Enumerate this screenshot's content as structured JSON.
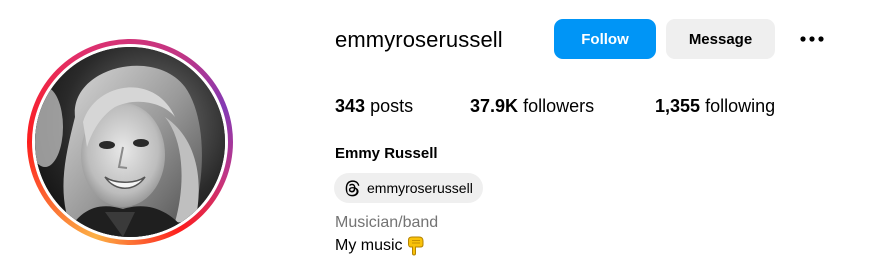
{
  "profile": {
    "username": "emmyroserussell",
    "full_name": "Emmy Russell",
    "threads_handle": "emmyroserussell",
    "category": "Musician/band",
    "bio_line": "My music",
    "bio_emoji_icon": "hand-pointing-down-icon"
  },
  "actions": {
    "follow_label": "Follow",
    "message_label": "Message",
    "more_icon": "more-options-icon"
  },
  "stats": {
    "posts_count": "343",
    "posts_label": "posts",
    "followers_count": "37.9K",
    "followers_label": "followers",
    "following_count": "1,355",
    "following_label": "following"
  },
  "colors": {
    "accent_blue": "#0095f6",
    "button_gray": "#efefef",
    "muted_text": "#737373"
  }
}
